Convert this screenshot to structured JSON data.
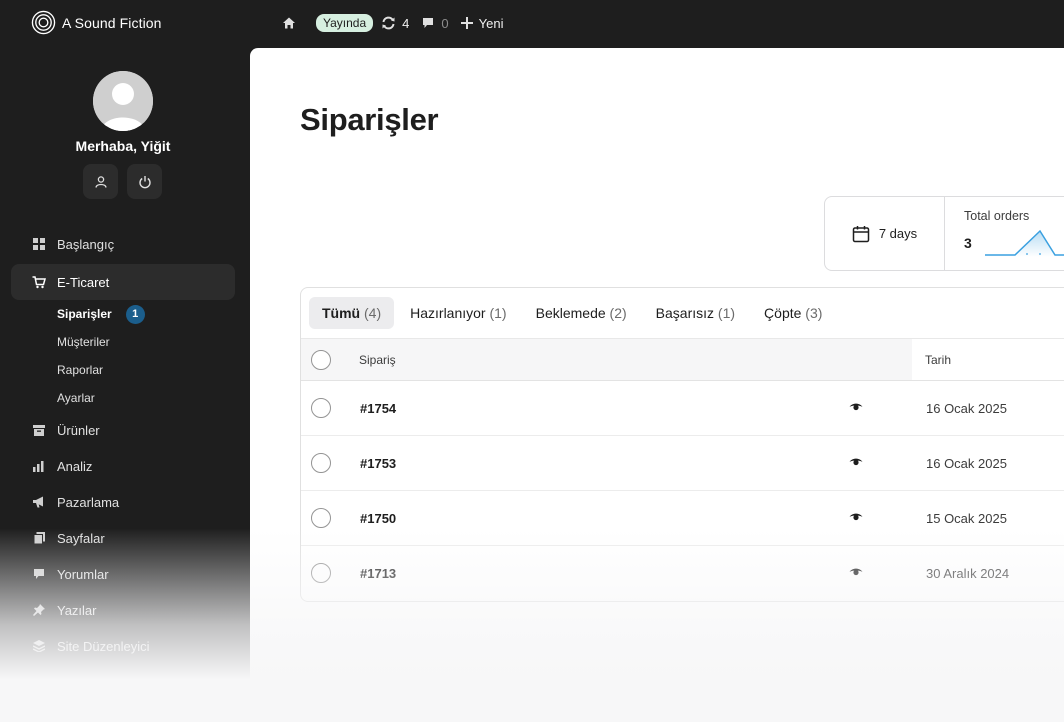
{
  "brand": {
    "name": "A Sound Fiction"
  },
  "topbar": {
    "home_icon": "home-icon",
    "status_badge": "Yayında",
    "updates_count": "4",
    "comments_count": "0",
    "new_label": "Yeni"
  },
  "sidebar": {
    "greeting": "Merhaba, Yiğit",
    "items": [
      {
        "label": "Başlangıç",
        "icon": "dashboard-icon"
      },
      {
        "label": "E-Ticaret",
        "icon": "cart-icon",
        "active": true
      },
      {
        "label": "Ürünler",
        "icon": "archive-icon"
      },
      {
        "label": "Analiz",
        "icon": "chart-bar-icon"
      },
      {
        "label": "Pazarlama",
        "icon": "megaphone-icon"
      },
      {
        "label": "Sayfalar",
        "icon": "pages-icon"
      },
      {
        "label": "Yorumlar",
        "icon": "comment-icon"
      },
      {
        "label": "Yazılar",
        "icon": "pin-icon"
      },
      {
        "label": "Site Düzenleyici",
        "icon": "layers-icon"
      }
    ],
    "submenu": [
      {
        "label": "Siparişler",
        "badge": "1",
        "current": true
      },
      {
        "label": "Müşteriler"
      },
      {
        "label": "Raporlar"
      },
      {
        "label": "Ayarlar"
      }
    ]
  },
  "main": {
    "title": "Siparişler",
    "stats": {
      "range": "7 days",
      "orders_label": "Total orders",
      "orders_value": "3"
    },
    "tabs": [
      {
        "label": "Tümü",
        "count": "(4)"
      },
      {
        "label": "Hazırlanıyor",
        "count": "(1)"
      },
      {
        "label": "Beklemede",
        "count": "(2)"
      },
      {
        "label": "Başarısız",
        "count": "(1)"
      },
      {
        "label": "Çöpte",
        "count": "(3)"
      }
    ],
    "columns": {
      "order": "Sipariş",
      "date": "Tarih"
    },
    "rows": [
      {
        "id": "#1754",
        "date": "16 Ocak 2025"
      },
      {
        "id": "#1753",
        "date": "16 Ocak 2025"
      },
      {
        "id": "#1750",
        "date": "15 Ocak 2025"
      },
      {
        "id": "#1713",
        "date": "30 Aralık 2024"
      }
    ]
  },
  "colors": {
    "accent": "#1b5e8c",
    "live_badge_bg": "#d6efe0",
    "sidebar_bg": "#1e1e1e",
    "spark": "#3aa0e0"
  }
}
